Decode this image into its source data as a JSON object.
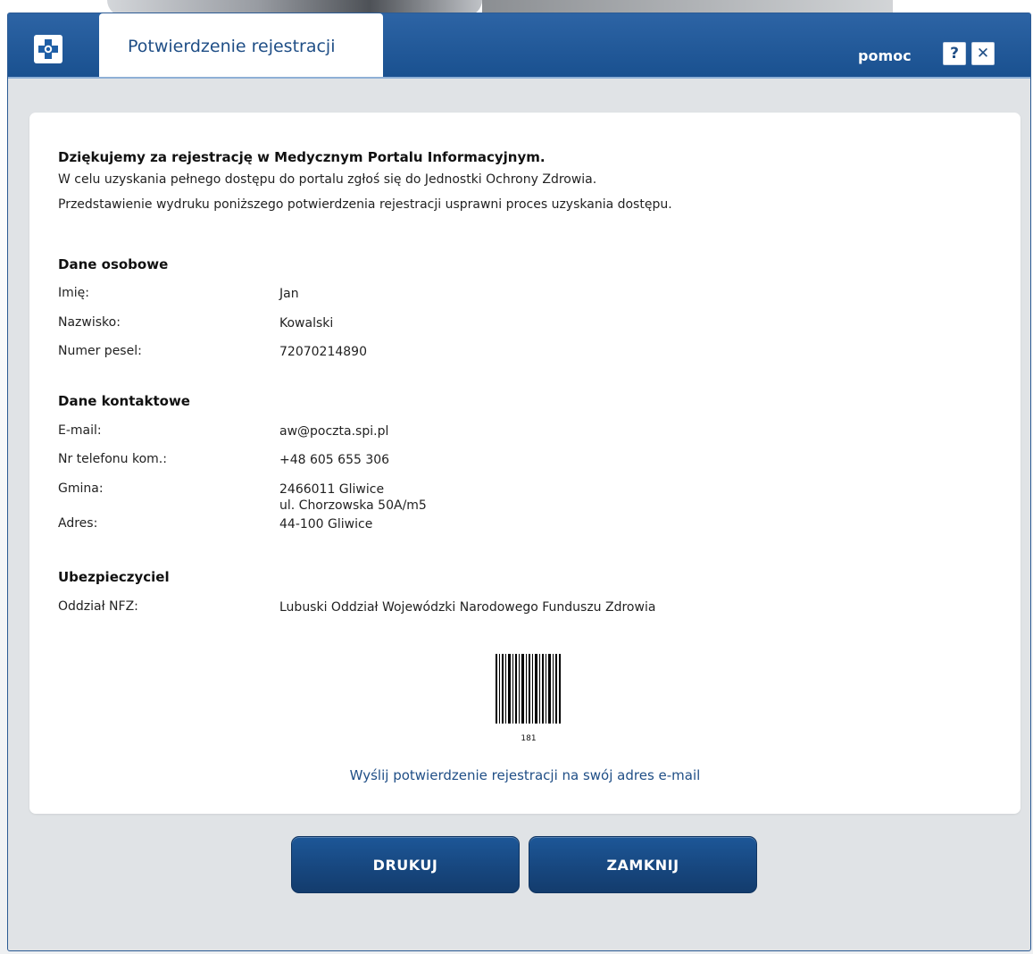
{
  "dialog": {
    "title": "Potwierdzenie rejestracji",
    "help_label": "pomoc",
    "help_button": "?",
    "close_button": "✕"
  },
  "intro": {
    "heading": "Dziękujemy za rejestrację w Medycznym Portalu Informacyjnym.",
    "line1": "W celu uzyskania pełnego dostępu do portalu zgłoś się do Jednostki Ochrony Zdrowia.",
    "line2": "Przedstawienie wydruku poniższego potwierdzenia rejestracji usprawni proces uzyskania dostępu."
  },
  "personal": {
    "heading": "Dane osobowe",
    "first_name_label": "Imię:",
    "first_name": "Jan",
    "last_name_label": "Nazwisko:",
    "last_name": "Kowalski",
    "pesel_label": "Numer pesel:",
    "pesel": "72070214890"
  },
  "contact": {
    "heading": "Dane kontaktowe",
    "email_label": "E-mail:",
    "email": "aw@poczta.spi.pl",
    "phone_label": "Nr telefonu kom.:",
    "phone": "+48 605 655 306",
    "commune_label": "Gmina:",
    "commune": "2466011 Gliwice",
    "address_label": "Adres:",
    "address_line1": "ul. Chorzowska 50A/m5",
    "address_line2": "44-100 Gliwice"
  },
  "insurer": {
    "heading": "Ubezpieczyciel",
    "branch_label": "Oddział NFZ:",
    "branch": "Lubuski Oddział Wojewódzki Narodowego Funduszu Zdrowia"
  },
  "barcode": {
    "number": "181"
  },
  "send_email_link": "Wyślij potwierdzenie rejestracji na swój adres e-mail",
  "buttons": {
    "print": "DRUKUJ",
    "close": "ZAMKNIJ"
  },
  "colors": {
    "primary": "#1f4e86",
    "titlebar": "#2d64a5",
    "background": "#e0e3e6"
  }
}
